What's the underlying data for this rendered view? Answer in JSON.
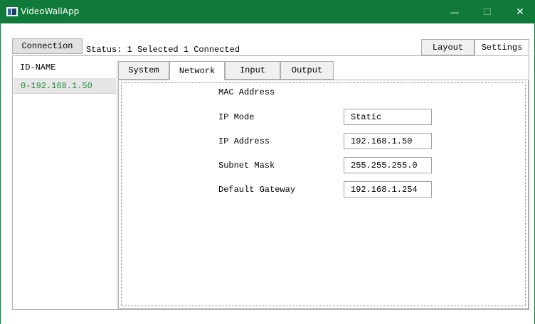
{
  "window": {
    "title": "VideoWallApp",
    "minimize_glyph": "—",
    "maximize_glyph": "☐",
    "close_glyph": "✕",
    "title_bar_color": "#0f7a3a"
  },
  "toolbar": {
    "connection_label": "Connection",
    "status_text": "Status: 1 Selected 1 Connected",
    "layout_label": "Layout",
    "settings_label": "Settings"
  },
  "device_list": {
    "header": "ID-NAME",
    "items": [
      {
        "label": "0-192.168.1.50",
        "selected": true
      }
    ],
    "item_text_color": "#1f8f3a"
  },
  "settings_tabs": [
    {
      "label": "System"
    },
    {
      "label": "Network",
      "active": true
    },
    {
      "label": "Input"
    },
    {
      "label": "Output"
    }
  ],
  "network": {
    "mac_label": "MAC Address",
    "ip_mode_label": "IP Mode",
    "ip_mode_value": "Static",
    "ip_address_label": "IP Address",
    "ip_address_value": "192.168.1.50",
    "subnet_mask_label": "Subnet Mask",
    "subnet_mask_value": "255.255.255.0",
    "gateway_label": "Default Gateway",
    "gateway_value": "192.168.1.254"
  }
}
